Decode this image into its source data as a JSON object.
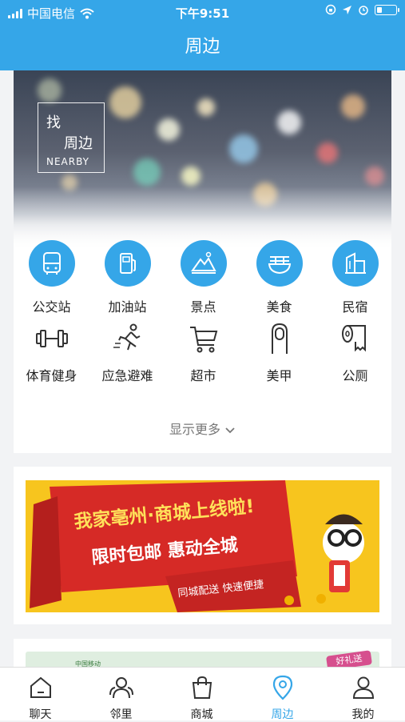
{
  "status_bar": {
    "carrier": "中国电信",
    "time": "下午9:51",
    "battery_percent": 25
  },
  "header": {
    "title": "周边"
  },
  "hero": {
    "badge_line1": "找",
    "badge_line2": "周边",
    "badge_en": "NEARBY"
  },
  "services": [
    {
      "label": "公交站",
      "icon": "bus-icon"
    },
    {
      "label": "加油站",
      "icon": "gas-station-icon"
    },
    {
      "label": "景点",
      "icon": "scenic-icon"
    },
    {
      "label": "美食",
      "icon": "noodle-bowl-icon"
    },
    {
      "label": "民宿",
      "icon": "building-icon"
    },
    {
      "label": "体育健身",
      "icon": "dumbbell-icon"
    },
    {
      "label": "应急避难",
      "icon": "running-person-icon"
    },
    {
      "label": "超市",
      "icon": "cart-icon"
    },
    {
      "label": "美甲",
      "icon": "nail-icon"
    },
    {
      "label": "公厕",
      "icon": "toilet-paper-icon"
    }
  ],
  "show_more": "显示更多",
  "promo": {
    "headline": "我家亳州·商城上线啦!",
    "subline": "限时包邮 惠动全城",
    "tags": "同城配送 快速便捷"
  },
  "next_card": {
    "text": "中国移动",
    "badge": "好礼送"
  },
  "tabbar": [
    {
      "label": "聊天",
      "icon": "home-icon",
      "active": false
    },
    {
      "label": "邻里",
      "icon": "neighbors-icon",
      "active": false
    },
    {
      "label": "商城",
      "icon": "shopping-bag-icon",
      "active": false
    },
    {
      "label": "周边",
      "icon": "location-pin-icon",
      "active": true
    },
    {
      "label": "我的",
      "icon": "profile-icon",
      "active": false
    }
  ],
  "colors": {
    "accent": "#35a6e8",
    "promo_yellow": "#f7c51e",
    "promo_red": "#d62a26"
  }
}
